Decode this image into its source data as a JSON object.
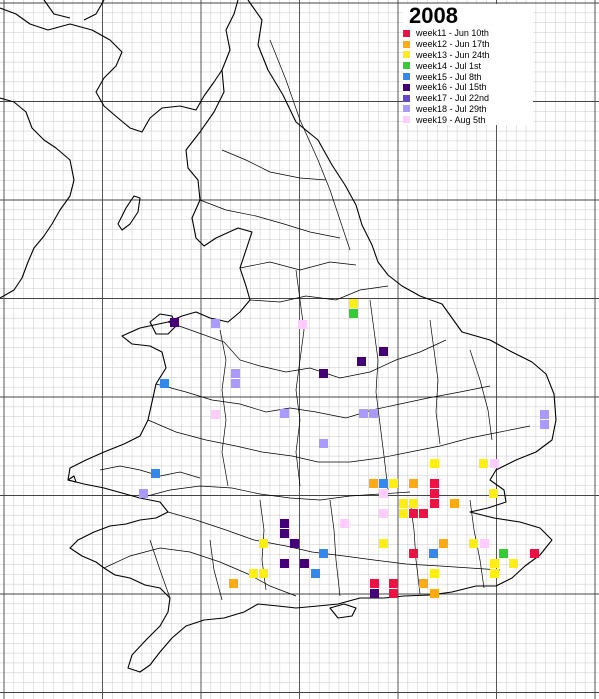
{
  "title": "2008",
  "legend": [
    {
      "label": "week11 - Jun 10th",
      "color": "#ee1144"
    },
    {
      "label": "week12 - Jun 17th",
      "color": "#ffaa11"
    },
    {
      "label": "week13 - Jun 24th",
      "color": "#ffee11"
    },
    {
      "label": "week14 - Jul 1st",
      "color": "#33cc33"
    },
    {
      "label": "week15 - Jul 8th",
      "color": "#3388ee"
    },
    {
      "label": "week16 - Jul 15th",
      "color": "#440077"
    },
    {
      "label": "week17 - Jul 22nd",
      "color": "#6644cc"
    },
    {
      "label": "week18 - Jul 29th",
      "color": "#aa99ff"
    },
    {
      "label": "week19 - Aug 5th",
      "color": "#ffccff"
    }
  ],
  "map": {
    "grid": {
      "fine_lines": true,
      "major_lines": true
    },
    "region": "England and Wales"
  }
}
